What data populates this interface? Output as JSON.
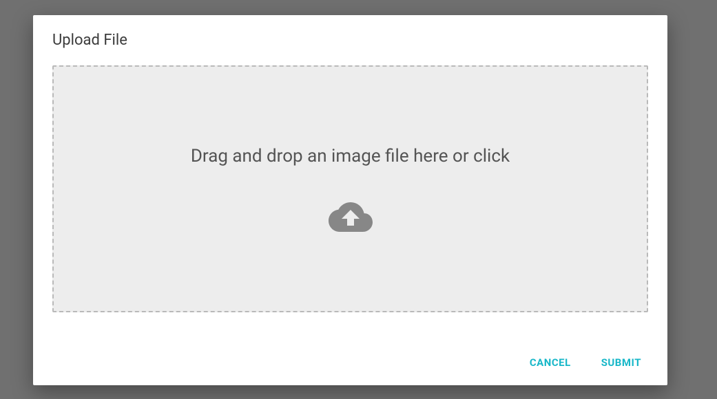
{
  "dialog": {
    "title": "Upload File"
  },
  "dropzone": {
    "prompt": "Drag and drop an image file here or click"
  },
  "actions": {
    "cancel_label": "CANCEL",
    "submit_label": "SUBMIT"
  },
  "colors": {
    "backdrop": "#707070",
    "surface": "#ffffff",
    "dropzone_bg": "#ededed",
    "dropzone_border": "#b9b9b9",
    "text_primary": "#3b3b3b",
    "text_secondary": "#545454",
    "accent": "#17b7c8",
    "icon": "#878787"
  }
}
